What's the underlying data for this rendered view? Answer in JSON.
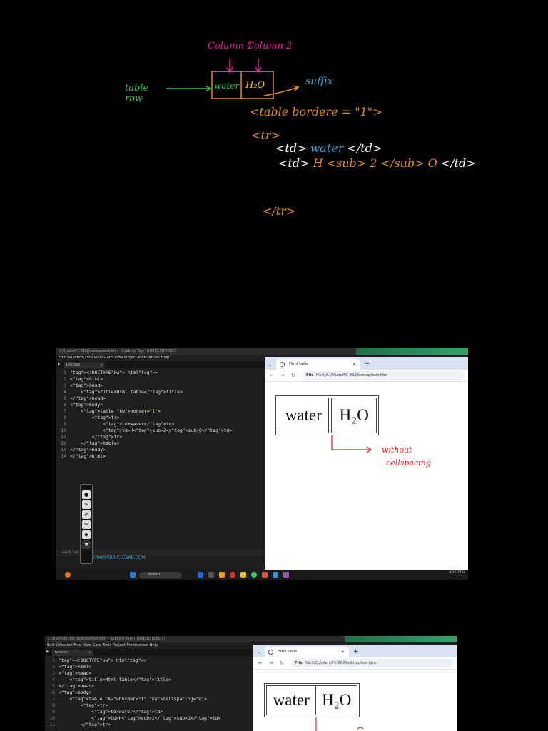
{
  "notes": {
    "column1": "Column 1",
    "column2": "Column 2",
    "table_row": "table row",
    "cell_water": "water",
    "cell_h2o": "H₂O",
    "suffix": "suffix",
    "code_line1": "<table bordere = \"1\">",
    "code_line2": "<tr>",
    "code_line3_open": "<td>",
    "code_line3_text": "water",
    "code_line3_close": "</td>",
    "code_line4_open": "<td>",
    "code_line4_h": "H",
    "code_line4_sub": "<sub> 2 </sub>",
    "code_line4_o": "O",
    "code_line4_close": "</td>",
    "code_line5": "</tr>"
  },
  "screenshot1": {
    "title": "C:\\Users\\FC-86\\Desktop\\test.htm - Sublime Text (UNREGISTERED)",
    "menu": "Edit  Selection  Find  View  Goto  Tools  Project  Preferences  Help",
    "file_tab": "test.htm",
    "code": [
      {
        "n": "1",
        "t": "<!DOCTYPE html>"
      },
      {
        "n": "2",
        "t": "<html>"
      },
      {
        "n": "3",
        "t": "<head>"
      },
      {
        "n": "4",
        "t": "    <title>Html table</title>"
      },
      {
        "n": "5",
        "t": "</head>"
      },
      {
        "n": "6",
        "t": "<body>"
      },
      {
        "n": "7",
        "t": "    <table border=\"1\">"
      },
      {
        "n": "8",
        "t": "        <tr>"
      },
      {
        "n": "9",
        "t": "            <td>water</td>"
      },
      {
        "n": "10",
        "t": "            <td>H<sub>2</sub>O</td>"
      },
      {
        "n": "11",
        "t": "        </tr>"
      },
      {
        "n": "12",
        "t": "    </table>"
      },
      {
        "n": "13",
        "t": "</body>"
      },
      {
        "n": "14",
        "t": "</html>"
      }
    ],
    "status": "Line 7, Col",
    "watermark": "V.TANVEERICTCARE.COM",
    "browser_tab": "Html table",
    "url_label": "File",
    "url": "file:///C:/Users/FC-86/Desktop/test.htm",
    "cell_water": "water",
    "cell_h2o": "H₂O",
    "annotation_line1": "without",
    "annotation_line2": "cellspacing",
    "search": "Search",
    "date": "9/26/2024"
  },
  "screenshot2": {
    "title": "C:\\Users\\FC-86\\Desktop\\test.htm - Sublime Text (UNREGISTERED)",
    "menu": "Edit  Selection  Find  View  Goto  Tools  Project  Preferences  Help",
    "file_tab": "test.htm",
    "code": [
      {
        "n": "1",
        "t": "<!DOCTYPE html>"
      },
      {
        "n": "2",
        "t": "<html>"
      },
      {
        "n": "3",
        "t": "<head>"
      },
      {
        "n": "4",
        "t": "    <title>Html table</title>"
      },
      {
        "n": "5",
        "t": "</head>"
      },
      {
        "n": "6",
        "t": "<body>"
      },
      {
        "n": "7",
        "t": "    <table border=\"1\" cellspacing=\"0\">"
      },
      {
        "n": "8",
        "t": "        <tr>"
      },
      {
        "n": "9",
        "t": "            <td>water</td>"
      },
      {
        "n": "10",
        "t": "            <td>H<sub>2</sub>O</td>"
      },
      {
        "n": "11",
        "t": "        </tr>"
      }
    ],
    "browser_tab": "Html table",
    "url_label": "File",
    "url": "file:///C:/Users/FC-86/Desktop/test.htm",
    "cell_water": "water",
    "cell_h2o": "H₂O"
  },
  "colors": {
    "accent_magenta": "#e0219a",
    "accent_orange": "#e88a1b",
    "accent_green": "#3cc43c",
    "accent_blue": "#3aa0d0",
    "accent_yellow": "#e8c21b",
    "annotation_red": "#e02020"
  }
}
